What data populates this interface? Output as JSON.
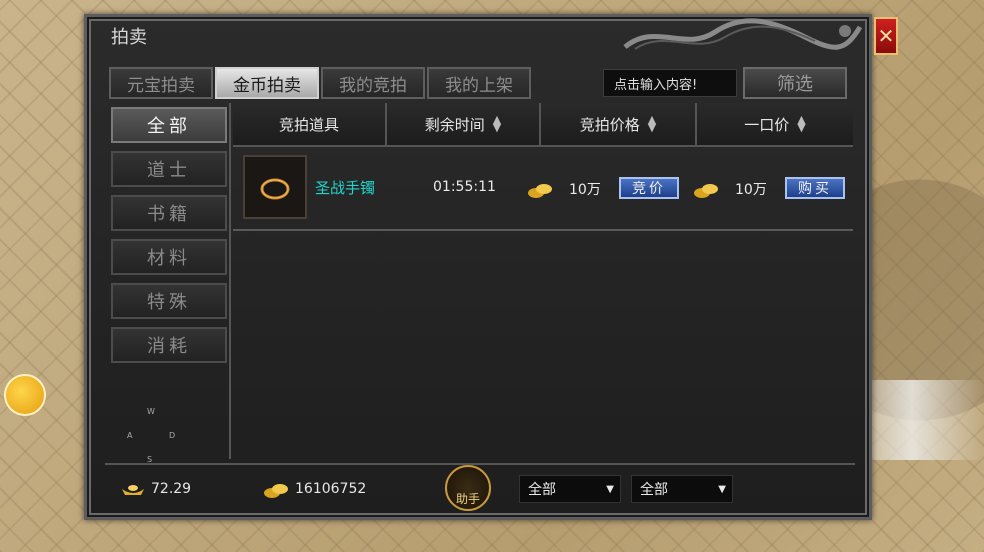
{
  "window": {
    "title": "拍卖",
    "close_label": "✕"
  },
  "tabs": [
    {
      "label": "元宝拍卖",
      "active": false
    },
    {
      "label": "金币拍卖",
      "active": true
    },
    {
      "label": "我的竞拍",
      "active": false
    },
    {
      "label": "我的上架",
      "active": false
    }
  ],
  "search": {
    "placeholder": "点击输入内容!"
  },
  "filter_label": "筛选",
  "categories": [
    "全部",
    "道士",
    "书籍",
    "材料",
    "特殊",
    "消耗"
  ],
  "compass": {
    "n": "W",
    "w": "A",
    "e": "D",
    "s": "S"
  },
  "table": {
    "headers": [
      "竞拍道具",
      "剩余时间",
      "竞拍价格",
      "一口价"
    ],
    "rows": [
      {
        "item_name": "圣战手镯",
        "time_left": "01:55:11",
        "bid_price": "10万",
        "bid_button": "竞价",
        "buyout_price": "10万",
        "buy_button": "购买"
      }
    ]
  },
  "footer": {
    "ingot_amount": "72.29",
    "gold_amount": "16106752",
    "helper_label": "助手",
    "dropdown1": "全部",
    "dropdown2": "全部"
  },
  "colors": {
    "item_name": "#1fd7d0",
    "blue_button": "#2f58b0",
    "close_button": "#c01818"
  }
}
